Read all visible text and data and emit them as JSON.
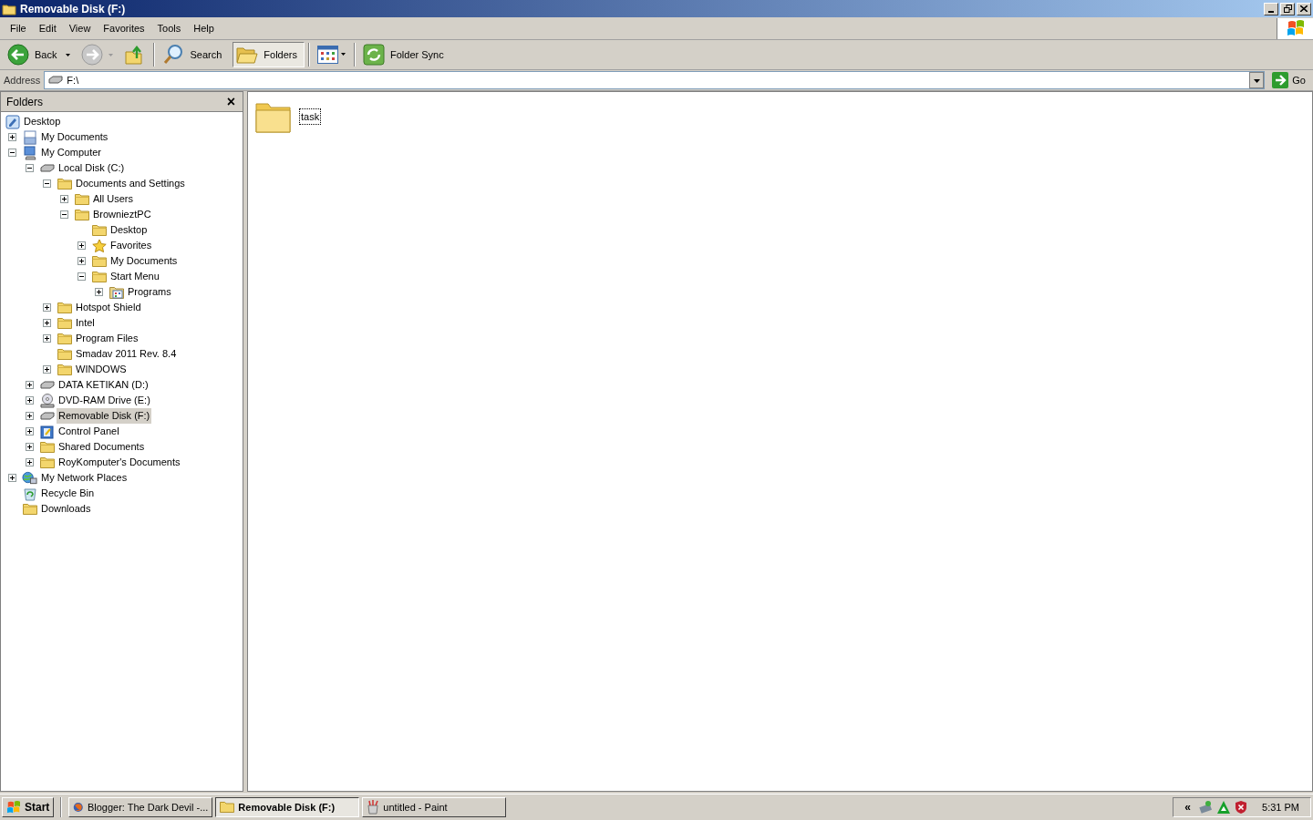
{
  "window": {
    "title": "Removable Disk (F:)"
  },
  "menu": [
    "File",
    "Edit",
    "View",
    "Favorites",
    "Tools",
    "Help"
  ],
  "toolbar": [
    {
      "kind": "back",
      "label": "Back"
    },
    {
      "kind": "forward"
    },
    {
      "kind": "up"
    },
    {
      "kind": "search",
      "label": "Search"
    },
    {
      "kind": "folders",
      "label": "Folders",
      "pressed": true
    },
    {
      "kind": "views"
    },
    {
      "kind": "sync",
      "label": "Folder Sync"
    }
  ],
  "address": {
    "label": "Address",
    "value": "F:\\",
    "go": "Go"
  },
  "folders_pane": {
    "title": "Folders",
    "close": "×",
    "tree": [
      {
        "label": "Desktop",
        "kind": "desktop",
        "selected": false,
        "children": [
          {
            "label": "My Documents",
            "kind": "mydocs",
            "expanded": false,
            "selected": false
          },
          {
            "label": "My Computer",
            "kind": "computer",
            "expanded": true,
            "selected": false,
            "children": [
              {
                "label": "Local Disk (C:)",
                "kind": "drive",
                "expanded": true,
                "selected": false,
                "children": [
                  {
                    "label": "Documents and Settings",
                    "kind": "folder",
                    "expanded": true,
                    "selected": false,
                    "children": [
                      {
                        "label": "All Users",
                        "kind": "folder",
                        "expanded": false,
                        "selected": false
                      },
                      {
                        "label": "BrownieztPC",
                        "kind": "folder",
                        "expanded": true,
                        "selected": false,
                        "children": [
                          {
                            "label": "Desktop",
                            "kind": "folder",
                            "selected": false
                          },
                          {
                            "label": "Favorites",
                            "kind": "star",
                            "expanded": false,
                            "selected": false
                          },
                          {
                            "label": "My Documents",
                            "kind": "folder",
                            "expanded": false,
                            "selected": false
                          },
                          {
                            "label": "Start Menu",
                            "kind": "folder",
                            "expanded": true,
                            "selected": false,
                            "children": [
                              {
                                "label": "Programs",
                                "kind": "programs",
                                "expanded": false,
                                "selected": false
                              }
                            ]
                          }
                        ]
                      }
                    ]
                  },
                  {
                    "label": "Hotspot Shield",
                    "kind": "folder",
                    "expanded": false,
                    "selected": false
                  },
                  {
                    "label": "Intel",
                    "kind": "folder",
                    "expanded": false,
                    "selected": false
                  },
                  {
                    "label": "Program Files",
                    "kind": "folder",
                    "expanded": false,
                    "selected": false
                  },
                  {
                    "label": "Smadav 2011 Rev. 8.4",
                    "kind": "folder",
                    "selected": false
                  },
                  {
                    "label": "WINDOWS",
                    "kind": "folder",
                    "expanded": false,
                    "selected": false
                  }
                ]
              },
              {
                "label": "DATA KETIKAN (D:)",
                "kind": "drive",
                "expanded": false,
                "selected": false
              },
              {
                "label": "DVD-RAM Drive (E:)",
                "kind": "dvd",
                "expanded": false,
                "selected": false
              },
              {
                "label": "Removable Disk (F:)",
                "kind": "drive",
                "expanded": false,
                "selected": true
              },
              {
                "label": "Control Panel",
                "kind": "control",
                "expanded": false,
                "selected": false
              },
              {
                "label": "Shared Documents",
                "kind": "folder",
                "expanded": false,
                "selected": false
              },
              {
                "label": "RoyKomputer's Documents",
                "kind": "folder",
                "expanded": false,
                "selected": false
              }
            ]
          },
          {
            "label": "My Network Places",
            "kind": "network",
            "expanded": false,
            "selected": false
          },
          {
            "label": "Recycle Bin",
            "kind": "recycle",
            "selected": false
          },
          {
            "label": "Downloads",
            "kind": "folder",
            "selected": false
          }
        ]
      }
    ]
  },
  "files": [
    {
      "name": "task",
      "focused": true
    }
  ],
  "taskbar": {
    "start": "Start",
    "tasks": [
      {
        "label": "Blogger: The Dark Devil -...",
        "kind": "browser",
        "selected": false
      },
      {
        "label": "Removable Disk (F:)",
        "kind": "folder",
        "selected": true
      },
      {
        "label": "untitled - Paint",
        "kind": "paint",
        "selected": false
      }
    ],
    "tray_expand": "«",
    "clock": "5:31 PM"
  }
}
